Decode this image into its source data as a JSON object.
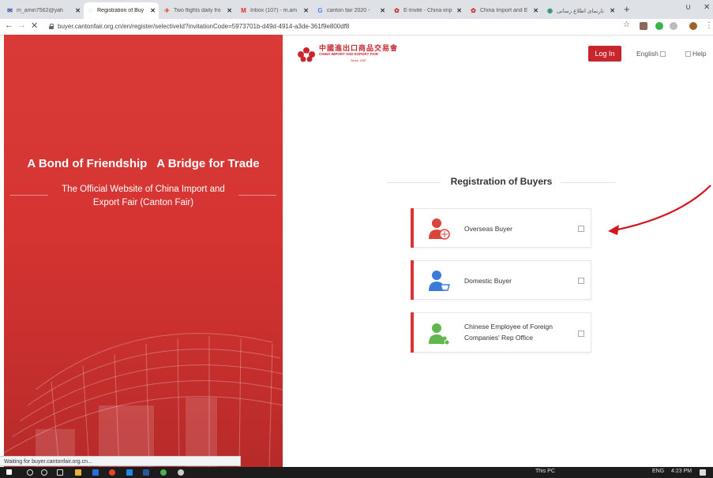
{
  "browser": {
    "tabs": [
      {
        "label": "m_amin7562@yah",
        "icon": "mail-icon",
        "color": "#2f4ea0"
      },
      {
        "label": "Registration of Buy",
        "icon": "loading-icon",
        "color": "#4a7bd8"
      },
      {
        "label": "Two flights daily fro",
        "icon": "plane-icon",
        "color": "#e0462c"
      },
      {
        "label": "Inbox (107) - m.am",
        "icon": "gmail-icon",
        "color": "#d93025"
      },
      {
        "label": "canton fair 2020 -",
        "icon": "google-icon",
        "color": "#4285f4"
      },
      {
        "label": "E-Invite - China imp",
        "icon": "canton-icon",
        "color": "#c8272d"
      },
      {
        "label": "China Import and E",
        "icon": "canton-icon",
        "color": "#c8272d"
      },
      {
        "label": "تارنمای اطلاع رسانی",
        "icon": "web-icon",
        "color": "#2a8f7d"
      }
    ],
    "url": "buyer.cantonfair.org.cn/en/register/selectiveId?invitationCode=5973701b-d49d-4914-a3de-361f9e800df8",
    "status": "Waiting for buyer.cantonfair.org.cn..."
  },
  "hero": {
    "title": "A Bond of Friendship   A Bridge for Trade",
    "subtitle": "The Official Website of China Import and Export Fair (Canton Fair)"
  },
  "header": {
    "logo_cn": "中國進出口商品交易會",
    "logo_en": "CHINA IMPORT AND EXPORT FAIR",
    "logo_since": "Since 1957",
    "login_label": "Log In",
    "language_label": "English",
    "help_label": "Help"
  },
  "registration": {
    "title": "Registration of Buyers",
    "options": [
      {
        "label": "Overseas Buyer",
        "color": "#d9443d"
      },
      {
        "label": "Domestic Buyer",
        "color": "#3b7ad9"
      },
      {
        "label": "Chinese Employee of Foreign Companies' Rep Office",
        "color": "#5fb74e"
      }
    ]
  },
  "taskbar": {
    "tray_text": "This PC",
    "language": "ENG",
    "time": "4:23 PM"
  }
}
